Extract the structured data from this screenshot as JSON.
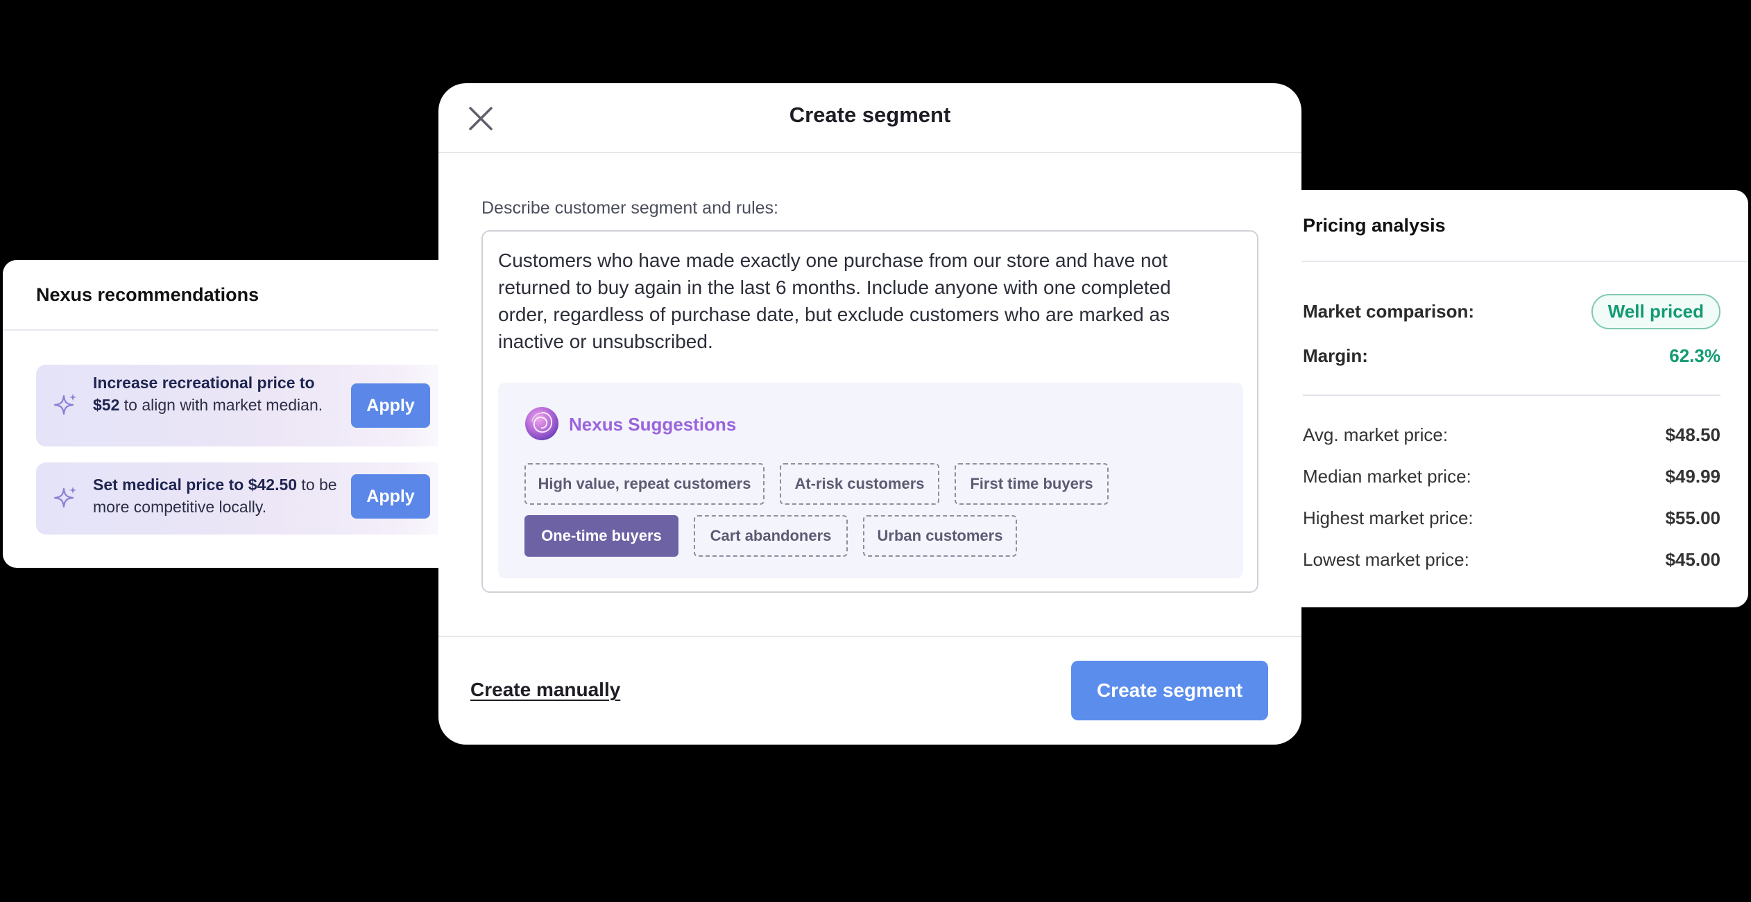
{
  "recommendations": {
    "title": "Nexus recommendations",
    "items": [
      {
        "parts": [
          {
            "text": "Increase recreational price to $52",
            "bold": true
          },
          {
            "text": " to align with market median.",
            "bold": false
          }
        ],
        "button": "Apply"
      },
      {
        "parts": [
          {
            "text": "Set medical price to $42.50",
            "bold": true
          },
          {
            "text": " to be more competitive locally.",
            "bold": false
          }
        ],
        "button": "Apply"
      }
    ]
  },
  "pricing": {
    "title": "Pricing analysis",
    "market_comparison_label": "Market comparison:",
    "market_comparison_badge": "Well priced",
    "margin_label": "Margin:",
    "margin_value": "62.3%",
    "rows": [
      {
        "label": "Avg. market price:",
        "value": "$48.50"
      },
      {
        "label": "Median market price:",
        "value": "$49.99"
      },
      {
        "label": "Highest market price:",
        "value": "$55.00"
      },
      {
        "label": "Lowest market price:",
        "value": "$45.00"
      }
    ]
  },
  "modal": {
    "title": "Create segment",
    "field_label": "Describe customer segment and rules:",
    "field_value": "Customers who have made exactly one purchase from our store and have not returned to buy again in the last 6 months. Include anyone with one completed order, regardless of purchase date, but exclude customers who are marked as inactive or unsubscribed.",
    "suggestions_title": "Nexus Suggestions",
    "chips": [
      {
        "label": "High value, repeat customers",
        "selected": false
      },
      {
        "label": "At-risk customers",
        "selected": false
      },
      {
        "label": "First time buyers",
        "selected": false
      },
      {
        "label": "One-time buyers",
        "selected": true
      },
      {
        "label": "Cart abandoners",
        "selected": false
      },
      {
        "label": "Urban customers",
        "selected": false
      }
    ],
    "create_manually": "Create manually",
    "create_button": "Create segment"
  },
  "colors": {
    "primary_button": "#5b8ded",
    "selected_chip": "#6c62a4",
    "success": "#139a72",
    "suggestion_title": "#9a64dc"
  }
}
